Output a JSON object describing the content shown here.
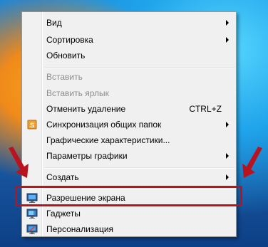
{
  "menu": {
    "items": [
      {
        "label": "Вид",
        "submenu": true
      },
      {
        "label": "Сортировка",
        "submenu": true
      },
      {
        "label": "Обновить"
      },
      {
        "label": "Вставить",
        "disabled": true
      },
      {
        "label": "Вставить ярлык",
        "disabled": true
      },
      {
        "label": "Отменить удаление",
        "shortcut": "CTRL+Z"
      },
      {
        "label": "Синхронизация общих папок",
        "submenu": true,
        "icon": "sync-icon"
      },
      {
        "label": "Графические характеристики..."
      },
      {
        "label": "Параметры графики",
        "submenu": true
      },
      {
        "label": "Создать",
        "submenu": true
      },
      {
        "label": "Разрешение экрана",
        "icon": "screen-resolution-icon"
      },
      {
        "label": "Гаджеты",
        "icon": "gadgets-icon"
      },
      {
        "label": "Персонализация",
        "icon": "personalization-icon"
      }
    ]
  },
  "colors": {
    "highlight": "#b8141f",
    "menu_background": "#f0f0f0",
    "disabled_text": "#8d8d8d"
  }
}
